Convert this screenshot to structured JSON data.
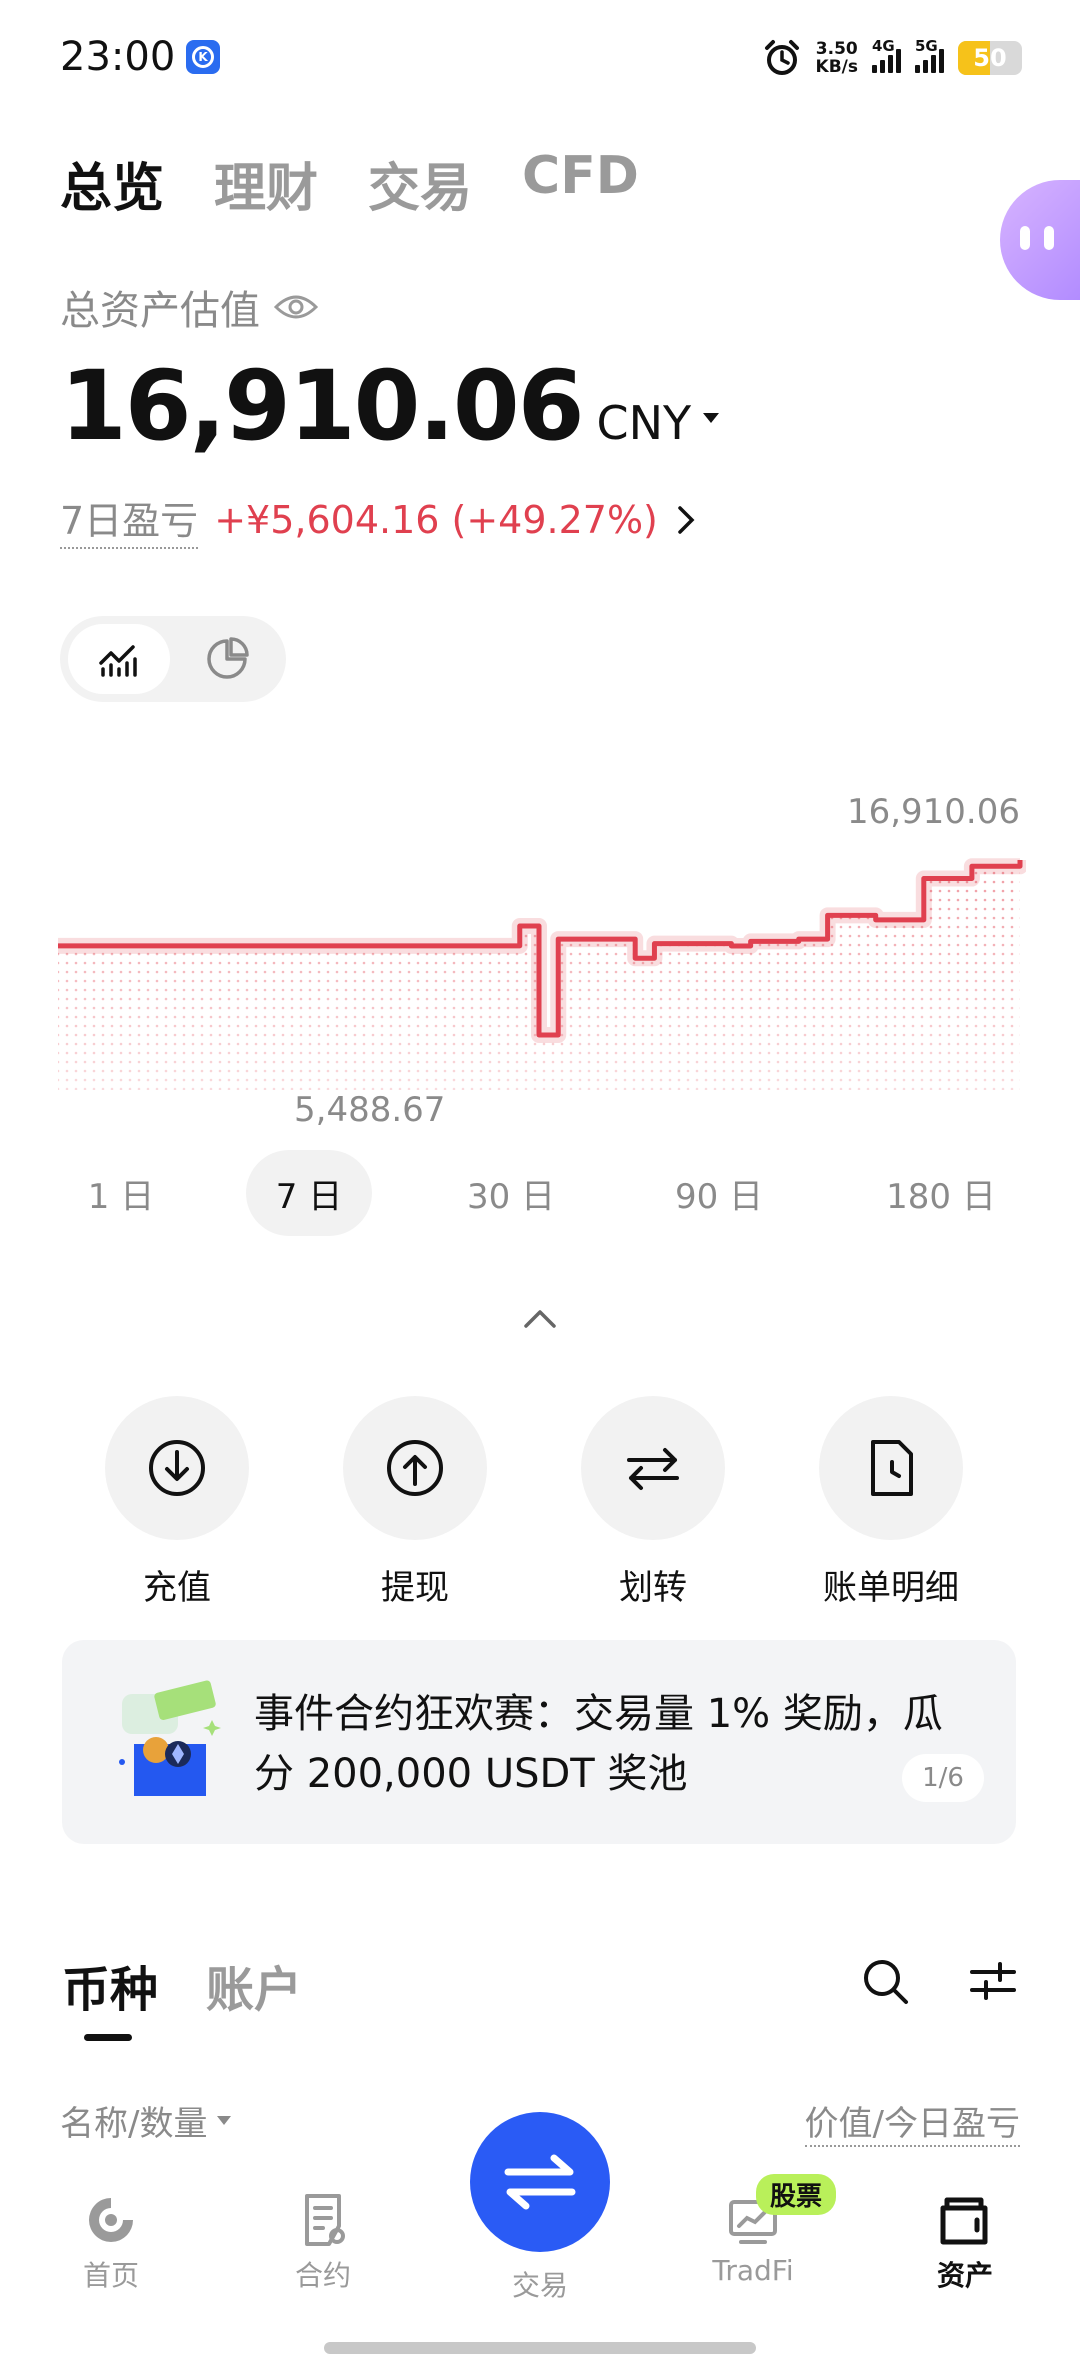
{
  "status_bar": {
    "time": "23:00",
    "net_speed_value": "3.50",
    "net_speed_unit": "KB/s",
    "sim1": "4G",
    "sim2": "5G",
    "battery": "50",
    "battery_level": 0.5
  },
  "top_tabs": [
    "总览",
    "理财",
    "交易",
    "CFD"
  ],
  "summary": {
    "label": "总资产估值",
    "value": "16,910.06",
    "currency": "CNY",
    "pnl_label": "7日盈亏",
    "pnl_value": "+¥5,604.16 (+49.27%)"
  },
  "chart_data": {
    "type": "line",
    "max_label": "16,910.06",
    "min_label": "5,488.67",
    "x": [
      0,
      20,
      40,
      48,
      50,
      52,
      55,
      60,
      62,
      70,
      72,
      77,
      80,
      85,
      90,
      95,
      100
    ],
    "values": [
      11306,
      11306,
      11306,
      12600,
      5488.67,
      11750,
      11750,
      10500,
      11450,
      11300,
      11600,
      11750,
      13300,
      13000,
      15700,
      16500,
      16910.06
    ],
    "range_buttons": [
      "1 日",
      "7 日",
      "30 日",
      "90 日",
      "180 日"
    ],
    "selected_range": "7 日",
    "line_color": "#e0404f"
  },
  "actions": [
    {
      "label": "充值",
      "icon": "deposit-icon"
    },
    {
      "label": "提现",
      "icon": "withdraw-icon"
    },
    {
      "label": "划转",
      "icon": "transfer-icon"
    },
    {
      "label": "账单明细",
      "icon": "bill-icon"
    }
  ],
  "banner": {
    "text": "事件合约狂欢赛：交易量 1% 奖励，瓜分 200,000 USDT 奖池",
    "pager": "1/6"
  },
  "sub_tabs": [
    "币种",
    "账户"
  ],
  "list_header": {
    "left": "名称/数量",
    "right": "价值/今日盈亏"
  },
  "bottom_nav": {
    "items": [
      {
        "label": "首页",
        "icon": "home-icon"
      },
      {
        "label": "合约",
        "icon": "contract-icon"
      },
      {
        "label": "交易",
        "icon": "trade-icon"
      },
      {
        "label": "TradFi",
        "icon": "tradfi-icon"
      },
      {
        "label": "资产",
        "icon": "assets-icon"
      }
    ],
    "badge": "股票",
    "active": "资产"
  }
}
